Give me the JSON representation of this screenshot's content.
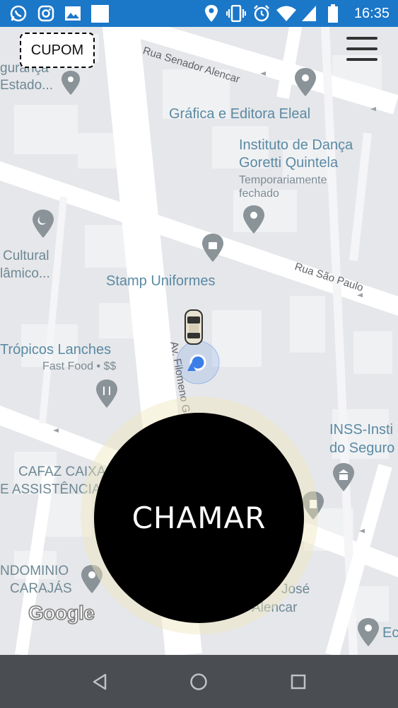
{
  "status_bar": {
    "time": "16:35",
    "left_icons": [
      "whatsapp-icon",
      "instagram-icon",
      "gallery-icon",
      "blank-notification-icon"
    ],
    "right_icons": [
      "location-icon",
      "vibrate-icon",
      "alarm-icon",
      "wifi-icon",
      "signal-icon",
      "battery-icon"
    ]
  },
  "header": {
    "coupon_label": "CUPOM",
    "menu_icon": "hamburger-menu-icon"
  },
  "map": {
    "streets": {
      "senador_alencar": "Rua Senador Alencar",
      "sao_paulo": "Rua São Paulo",
      "filomeno": "Av. Filomeno G"
    },
    "places": {
      "grafica": "Gráfica e Editora Eleal",
      "danca_1": "Instituto de Dança",
      "danca_2": "Goretti Quintela",
      "danca_status_1": "Temporariamente",
      "danca_status_2": "fechado",
      "cultural_1": "Cultural",
      "cultural_2": "lâmico...",
      "stamp": "Stamp Uniformes",
      "tropicos": "Trópicos Lanches",
      "tropicos_sub": "Fast Food • $$",
      "inss_1": "INSS-Insti",
      "inss_2": "do Seguro",
      "cafaz_1": "CAFAZ CAIXA",
      "cafaz_2": "E ASSISTÊNCIA",
      "condominio_1": "NDOMINIO",
      "condominio_2": "CARAJÁS",
      "jose_1": "José",
      "jose_2": "Alencar",
      "seguranca_1": "gurança",
      "seguranca_2": "Estado...",
      "ec": "Ec"
    },
    "attribution": "Google"
  },
  "action": {
    "call_label": "CHAMAR"
  },
  "nav_bar": {
    "icons": [
      "back-icon",
      "home-icon",
      "recents-icon"
    ]
  },
  "colors": {
    "status_bar": "#1b77c8",
    "map_bg": "#e6e7ea",
    "road": "#ffffff",
    "poi_text": "#5a8aa4",
    "call_button": "#000000",
    "nav_bar": "#4a4d52",
    "location_dot": "#3b7ee8"
  }
}
